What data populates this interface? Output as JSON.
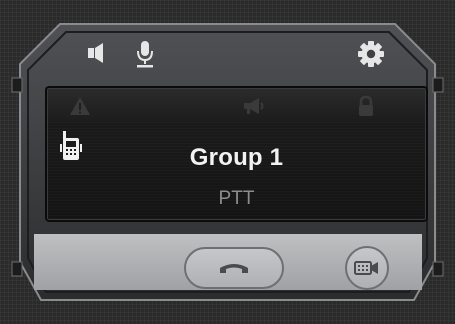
{
  "screen": {
    "group_name": "Group 1",
    "mode_label": "PTT"
  },
  "icons": {
    "speaker": "speaker-icon",
    "microphone": "microphone-icon",
    "settings": "gear-icon",
    "warning": "warning-icon",
    "megaphone": "megaphone-icon",
    "lock": "lock-icon",
    "radio": "walkie-talkie-icon",
    "end_call": "end-call-icon",
    "video_call": "video-call-icon"
  },
  "colors": {
    "frame": "#3a3b3d",
    "frame_edge": "#8a8b8d",
    "screen_bg": "#161616",
    "group_text": "#f2f2f2",
    "mode_text": "#8d8d8d",
    "bottom_panel": "#b1b2b5"
  }
}
